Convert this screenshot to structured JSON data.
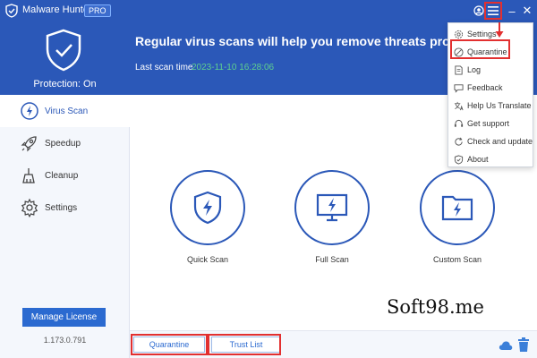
{
  "app": {
    "title": "Malware Hunter",
    "badge": "PRO",
    "accent": "#2b58b8",
    "highlight": "#e23030"
  },
  "window_controls": {
    "user": "user-icon",
    "menu": "hamburger-menu-icon",
    "minimize": "–",
    "close": "✕"
  },
  "protection": {
    "status": "Protection: On",
    "icon": "shield-check-icon"
  },
  "sidebar": {
    "items": [
      {
        "label": "Virus Scan",
        "icon": "virus-scan-icon",
        "active": true
      },
      {
        "label": "Speedup",
        "icon": "rocket-icon",
        "active": false
      },
      {
        "label": "Cleanup",
        "icon": "broom-icon",
        "active": false
      },
      {
        "label": "Settings",
        "icon": "gear-icon",
        "active": false
      }
    ],
    "manage_license": "Manage License",
    "version": "1.173.0.791"
  },
  "header": {
    "message": "Regular virus scans will help you remove threats promp",
    "last_scan_label": "Last scan time",
    "last_scan_value": "2023-11-10 16:28:06"
  },
  "scans": [
    {
      "label": "Quick Scan",
      "icon": "shield-bolt-icon"
    },
    {
      "label": "Full Scan",
      "icon": "monitor-bolt-icon"
    },
    {
      "label": "Custom Scan",
      "icon": "folder-bolt-icon"
    }
  ],
  "footer": {
    "quarantine": "Quarantine",
    "trust_list": "Trust List"
  },
  "menu": {
    "items": [
      {
        "label": "Settings",
        "icon": "gear-icon"
      },
      {
        "label": "Quarantine",
        "icon": "block-icon"
      },
      {
        "label": "Log",
        "icon": "document-icon"
      },
      {
        "label": "Feedback",
        "icon": "chat-icon"
      },
      {
        "label": "Help Us Translate",
        "icon": "translate-icon"
      },
      {
        "label": "Get support",
        "icon": "support-icon"
      },
      {
        "label": "Check and update",
        "icon": "refresh-icon"
      },
      {
        "label": "About",
        "icon": "shield-icon"
      }
    ]
  },
  "watermark": "Soft98.me"
}
